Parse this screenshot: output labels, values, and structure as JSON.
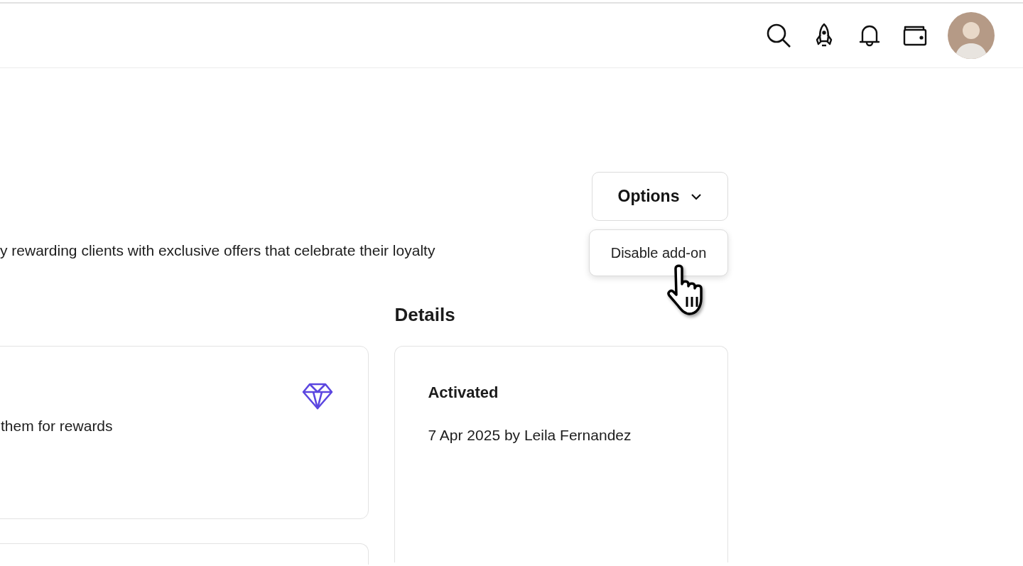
{
  "options_button": {
    "label": "Options"
  },
  "dropdown": {
    "items": [
      {
        "label": "Disable add-on",
        "hovered": true
      }
    ]
  },
  "description": "y rewarding clients with exclusive offers that celebrate their loyalty",
  "cards": [
    {
      "text": "them for rewards"
    }
  ],
  "details": {
    "heading": "Details",
    "items": [
      {
        "label": "Activated",
        "value": "7 Apr 2025 by Leila Fernandez"
      }
    ]
  }
}
